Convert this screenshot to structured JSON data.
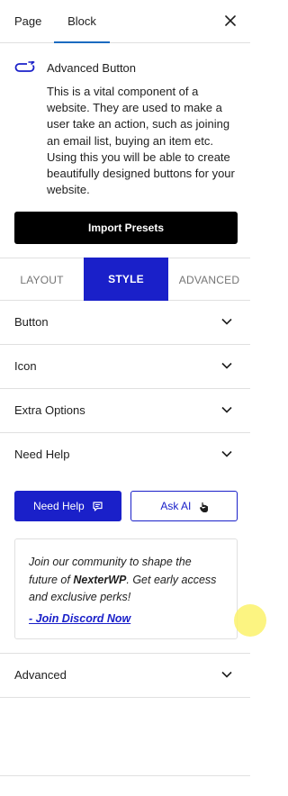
{
  "tabs": {
    "page": "Page",
    "block": "Block",
    "active": "Block"
  },
  "block": {
    "title": "Advanced Button",
    "icon": "button-link-icon",
    "description": "This is a vital component of a website. They are used to make a user take an action, such as joining an email list, buying an item etc. Using this you will be able to create beautifully designed buttons for your website."
  },
  "import_presets": "Import Presets",
  "panel_tabs": {
    "layout": "LAYOUT",
    "style": "STYLE",
    "advanced": "ADVANCED",
    "active": "STYLE"
  },
  "sections": {
    "button": "Button",
    "icon": "Icon",
    "extra_options": "Extra Options",
    "need_help": "Need Help",
    "advanced": "Advanced"
  },
  "help": {
    "need_help_button": "Need Help",
    "ask_ai_button": "Ask AI"
  },
  "community": {
    "text_before": "Join our community to shape the future of ",
    "brand": "NexterWP",
    "text_after": ". Get early access and exclusive perks!",
    "link": "- Join Discord Now"
  },
  "colors": {
    "accent": "#1a20c9",
    "tab_underline": "#1b6bc0",
    "cursor_highlight": "#fbf26b"
  }
}
